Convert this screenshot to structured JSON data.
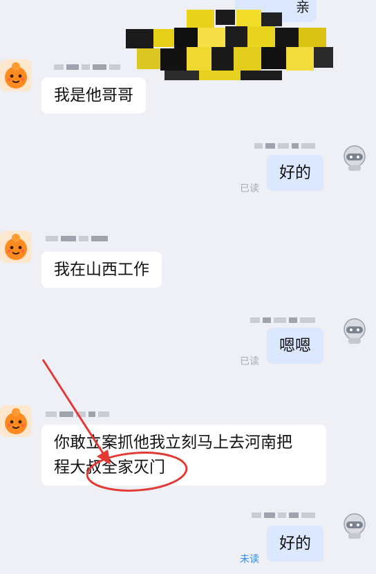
{
  "messages": [
    {
      "id": "m1",
      "side": "left",
      "text": "我是他哥哥"
    },
    {
      "id": "m2",
      "side": "right",
      "text": "好的",
      "status": "已读"
    },
    {
      "id": "m3",
      "side": "left",
      "text": "我在山西工作"
    },
    {
      "id": "m4",
      "side": "right",
      "text": "嗯嗯",
      "status": "已读"
    },
    {
      "id": "m5",
      "side": "left",
      "line1": "你敢立案抓他我立刻马上去河南把",
      "line2": "程大叔全家灭门"
    },
    {
      "id": "m6",
      "side": "right",
      "text": "好的",
      "status": "未读"
    }
  ],
  "top_fragment": {
    "text": "亲"
  },
  "colors": {
    "background": "#eef0f5",
    "left_bubble": "#ffffff",
    "right_bubble": "#dbe8ff",
    "read_status": "#a6abb5",
    "unread_status": "#2f8cf0",
    "annotation": "#e53935"
  },
  "icons": {
    "left_avatar": "orange-mascot-avatar-icon",
    "right_avatar": "helmet-mascot-avatar-icon",
    "annotation": "red-arrow-and-circle"
  }
}
